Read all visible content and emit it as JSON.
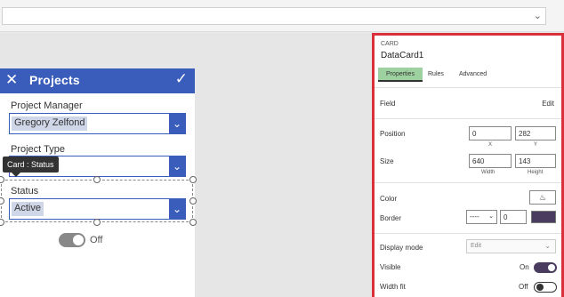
{
  "formula_bar": {
    "value": ""
  },
  "app": {
    "title": "Projects",
    "fields": [
      {
        "label": "Project Manager",
        "value": "Gregory Zelfond"
      },
      {
        "label": "Project Type",
        "value": ""
      },
      {
        "label": "Status",
        "value": "Active"
      }
    ],
    "tooltip": "Card : Status",
    "toggle": {
      "label": "Off",
      "state": "off"
    }
  },
  "panel": {
    "type_label": "CARD",
    "control_name": "DataCard1",
    "tabs": [
      {
        "label": "Properties",
        "active": true
      },
      {
        "label": "Rules",
        "active": false
      },
      {
        "label": "Advanced",
        "active": false
      }
    ],
    "field": {
      "label": "Field",
      "action": "Edit"
    },
    "position": {
      "label": "Position",
      "x": "0",
      "y": "282",
      "x_label": "X",
      "y_label": "Y"
    },
    "size": {
      "label": "Size",
      "width": "640",
      "height": "143",
      "width_label": "Width",
      "height_label": "Height"
    },
    "color": {
      "label": "Color"
    },
    "border": {
      "label": "Border",
      "style": "----",
      "width": "0",
      "color": "#4a3c5e"
    },
    "display_mode": {
      "label": "Display mode",
      "value": "Edit"
    },
    "visible": {
      "label": "Visible",
      "state_text": "On"
    },
    "width_fit": {
      "label": "Width fit",
      "state_text": "Off"
    }
  },
  "colors": {
    "accent": "#3a5dbb",
    "highlight_border": "#d9303b",
    "active_tab": "#9ed1a0"
  }
}
